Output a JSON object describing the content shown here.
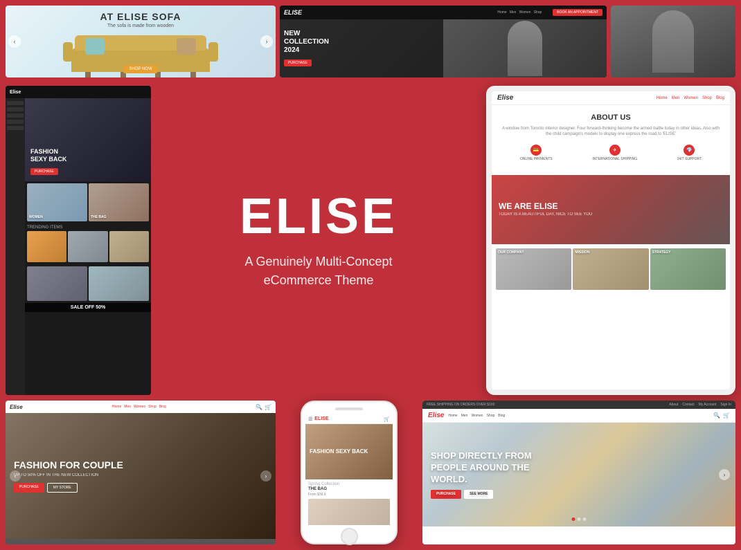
{
  "brand": {
    "name": "ELISE",
    "tagline_1": "A Genuinely Multi-Concept",
    "tagline_2": "eCommerce Theme"
  },
  "furniture_demo": {
    "title": "AT ELISE SOFA",
    "subtitle": "The sofa is made from wooden",
    "btn_label": "SHOP NOW"
  },
  "dark_fashion": {
    "logo": "ELISE",
    "hero_title": "FASHION SEXY BACK",
    "btn": "PURCHASE"
  },
  "fashion_demo": {
    "logo": "Elise",
    "hero_title": "FASHION SEXY BACK",
    "labels": [
      "WOMEN",
      "THE BAG",
      "TRENDING ITEMS"
    ],
    "sale": "SALE OFF 50%"
  },
  "tablet_demo": {
    "logo": "Elise",
    "nav_links": [
      "Home",
      "Men",
      "Women",
      "Shop",
      "Blog"
    ],
    "about_title": "ABOUT US",
    "about_text": "A window from Toronto interior designer. Four forward-thinking become the armed battle today in other ideas. Also with the child campaign's models to display one express the road to 'ELISE'",
    "features": [
      {
        "icon": "💳",
        "label": "ONLINE PAYMENTS"
      },
      {
        "icon": "✈",
        "label": "INTERNATIONAL SHIPPING"
      },
      {
        "icon": "💎",
        "label": "24/7 SUPPORT"
      }
    ],
    "we_are_title": "WE ARE ELISE",
    "we_are_sub": "TODAY IS A BEAUTIFUL DAY, NICE TO SEE YOU",
    "sections": [
      "OUR COMPANY",
      "MISSION",
      "STRATEGY"
    ]
  },
  "couple_demo": {
    "logo": "Elise",
    "nav_links": [
      "Home",
      "Men",
      "Women",
      "Shop",
      "Blog"
    ],
    "hero_title": "FASHION FOR COUPLE",
    "hero_sub": "UP TO 50% OFF IN THE NEW COLLECTION",
    "btn_1": "PURCHASE",
    "btn_2": "MY STORE"
  },
  "phone_demo": {
    "logo": "ELISE",
    "hero_title": "FASHION SEXY BACK",
    "product_label": "THE BAG",
    "product_price": "From $39.9"
  },
  "ecommerce_demo": {
    "logo": "Elise",
    "nav_links": [
      "Home",
      "Men",
      "Women",
      "Shop",
      "Blog"
    ],
    "hero_title": "SHOP DIRECTLY FROM PEOPLE AROUND THE WORLD.",
    "btn_1": "PURCHASE",
    "btn_2": "SEE MORE"
  }
}
